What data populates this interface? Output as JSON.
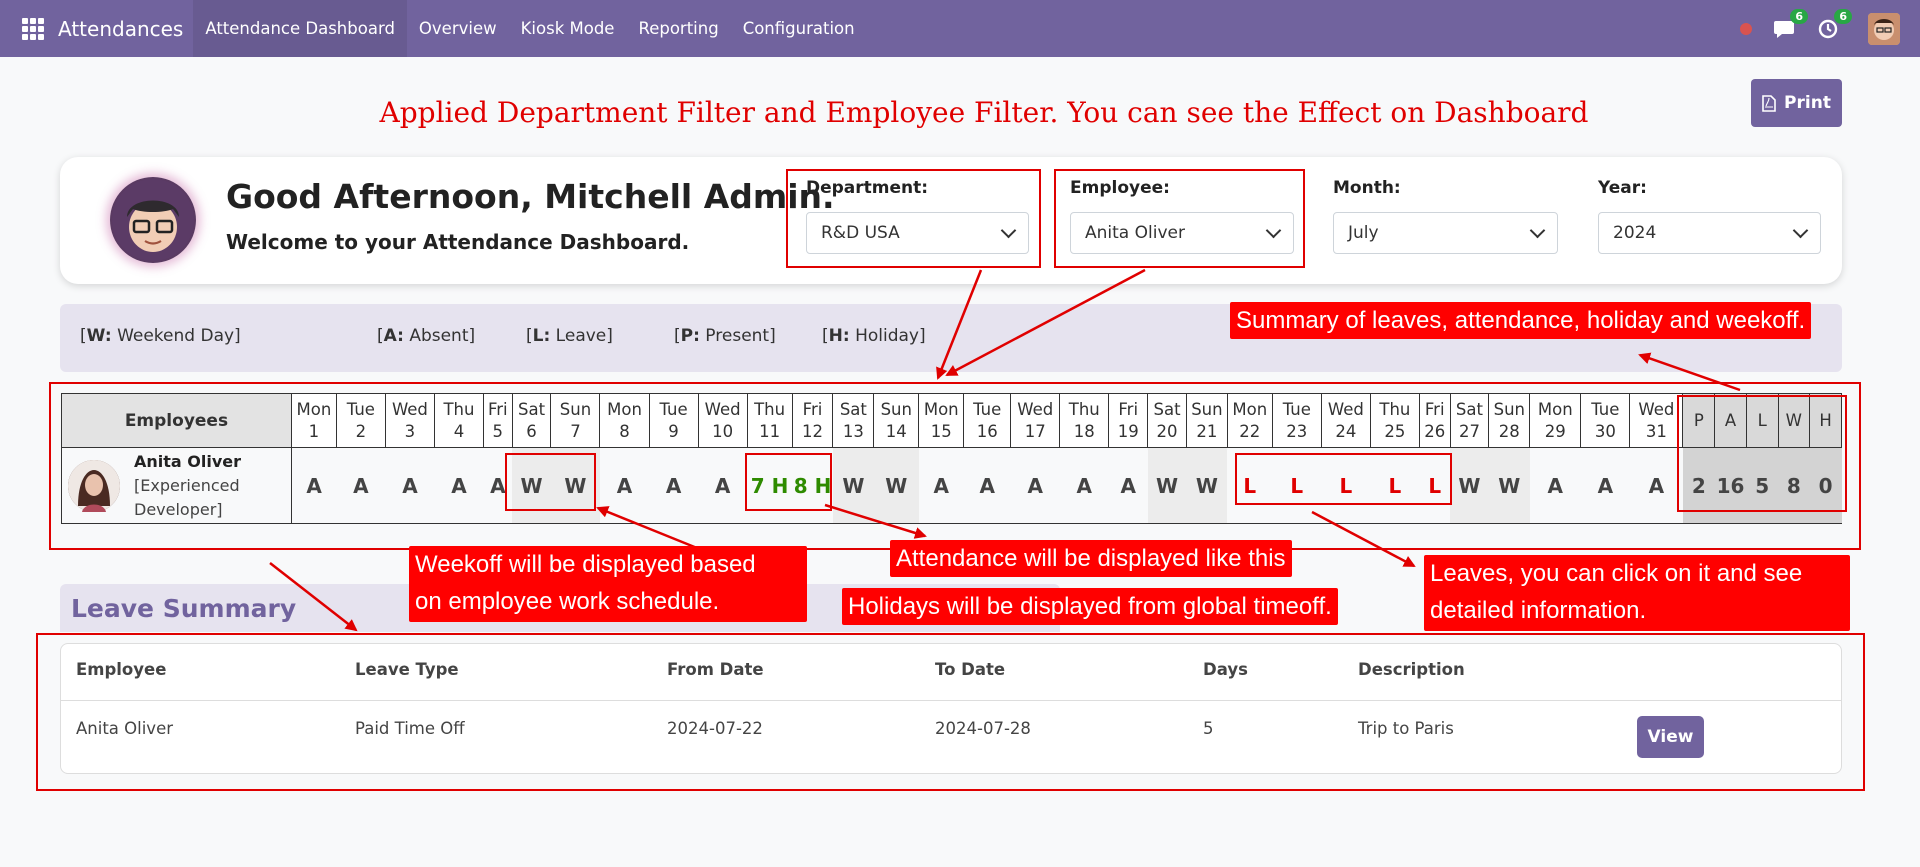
{
  "nav": {
    "apps_icon": "apps-grid-icon",
    "brand": "Attendances",
    "menu": [
      "Attendance Dashboard",
      "Overview",
      "Kiosk Mode",
      "Reporting",
      "Configuration"
    ],
    "messages_badge": "6",
    "activities_badge": "6"
  },
  "print_button": "Print",
  "banner": "Applied Department Filter and Employee Filter. You can see the Effect on Dashboard",
  "greeting": {
    "title": "Good Afternoon, Mitchell Admin.",
    "subtitle": "Welcome to your Attendance Dashboard."
  },
  "filters": {
    "department": {
      "label": "Department:",
      "value": "R&D USA"
    },
    "employee": {
      "label": "Employee:",
      "value": "Anita Oliver"
    },
    "month": {
      "label": "Month:",
      "value": "July"
    },
    "year": {
      "label": "Year:",
      "value": "2024"
    }
  },
  "legend": [
    {
      "key": "W:",
      "text": " Weekend Day]"
    },
    {
      "key": "A:",
      "text": " Absent]"
    },
    {
      "key": "L:",
      "text": " Leave]"
    },
    {
      "key": "P:",
      "text": " Present]"
    },
    {
      "key": "H:",
      "text": " Holiday]"
    }
  ],
  "table": {
    "employees_header": "Employees",
    "days": [
      {
        "d": "Mon",
        "n": "1",
        "v": "A",
        "t": ""
      },
      {
        "d": "Tue",
        "n": "2",
        "v": "A",
        "t": ""
      },
      {
        "d": "Wed",
        "n": "3",
        "v": "A",
        "t": ""
      },
      {
        "d": "Thu",
        "n": "4",
        "v": "A",
        "t": ""
      },
      {
        "d": "Fri",
        "n": "5",
        "v": "A",
        "t": ""
      },
      {
        "d": "Sat",
        "n": "6",
        "v": "W",
        "t": "wk"
      },
      {
        "d": "Sun",
        "n": "7",
        "v": "W",
        "t": "wk"
      },
      {
        "d": "Mon",
        "n": "8",
        "v": "A",
        "t": ""
      },
      {
        "d": "Tue",
        "n": "9",
        "v": "A",
        "t": ""
      },
      {
        "d": "Wed",
        "n": "10",
        "v": "A",
        "t": ""
      },
      {
        "d": "Thu",
        "n": "11",
        "v": "7 H",
        "t": "hol"
      },
      {
        "d": "Fri",
        "n": "12",
        "v": "8 H",
        "t": "hol"
      },
      {
        "d": "Sat",
        "n": "13",
        "v": "W",
        "t": "wk"
      },
      {
        "d": "Sun",
        "n": "14",
        "v": "W",
        "t": "wk"
      },
      {
        "d": "Mon",
        "n": "15",
        "v": "A",
        "t": ""
      },
      {
        "d": "Tue",
        "n": "16",
        "v": "A",
        "t": ""
      },
      {
        "d": "Wed",
        "n": "17",
        "v": "A",
        "t": ""
      },
      {
        "d": "Thu",
        "n": "18",
        "v": "A",
        "t": ""
      },
      {
        "d": "Fri",
        "n": "19",
        "v": "A",
        "t": ""
      },
      {
        "d": "Sat",
        "n": "20",
        "v": "W",
        "t": "wk"
      },
      {
        "d": "Sun",
        "n": "21",
        "v": "W",
        "t": "wk"
      },
      {
        "d": "Mon",
        "n": "22",
        "v": "L",
        "t": "lv"
      },
      {
        "d": "Tue",
        "n": "23",
        "v": "L",
        "t": "lv"
      },
      {
        "d": "Wed",
        "n": "24",
        "v": "L",
        "t": "lv"
      },
      {
        "d": "Thu",
        "n": "25",
        "v": "L",
        "t": "lv"
      },
      {
        "d": "Fri",
        "n": "26",
        "v": "L",
        "t": "lv"
      },
      {
        "d": "Sat",
        "n": "27",
        "v": "W",
        "t": "wk"
      },
      {
        "d": "Sun",
        "n": "28",
        "v": "W",
        "t": "wk"
      },
      {
        "d": "Mon",
        "n": "29",
        "v": "A",
        "t": ""
      },
      {
        "d": "Tue",
        "n": "30",
        "v": "A",
        "t": ""
      },
      {
        "d": "Wed",
        "n": "31",
        "v": "A",
        "t": ""
      }
    ],
    "summary_headers": [
      "P",
      "A",
      "L",
      "W",
      "H"
    ],
    "summary_values": [
      "2",
      "16",
      "5",
      "8",
      "0"
    ],
    "employee": {
      "name": "Anita Oliver",
      "role": "[Experienced Developer]"
    }
  },
  "annotations": {
    "summary_note": "Summary of leaves, attendance, holiday and weekoff.",
    "weekoff_note_1": "Weekoff will be displayed based",
    "weekoff_note_2": "on employee work schedule.",
    "attendance_note": "Attendance will be displayed like this",
    "holidays_note": "Holidays will be displayed from global timeoff.",
    "leaves_note_1": "Leaves, you can click on it and see",
    "leaves_note_2": "detailed information."
  },
  "leave_summary": {
    "title": "Leave Summary",
    "headers": [
      "Employee",
      "Leave Type",
      "From Date",
      "To Date",
      "Days",
      "Description"
    ],
    "row": [
      "Anita Oliver",
      "Paid Time Off",
      "2024-07-22",
      "2024-07-28",
      "5",
      "Trip to Paris"
    ],
    "view_button": "View"
  },
  "colors": {
    "brand": "#71639e",
    "annotation": "#ff0000",
    "holiday": "#2e8b00",
    "leave": "#e00000"
  }
}
